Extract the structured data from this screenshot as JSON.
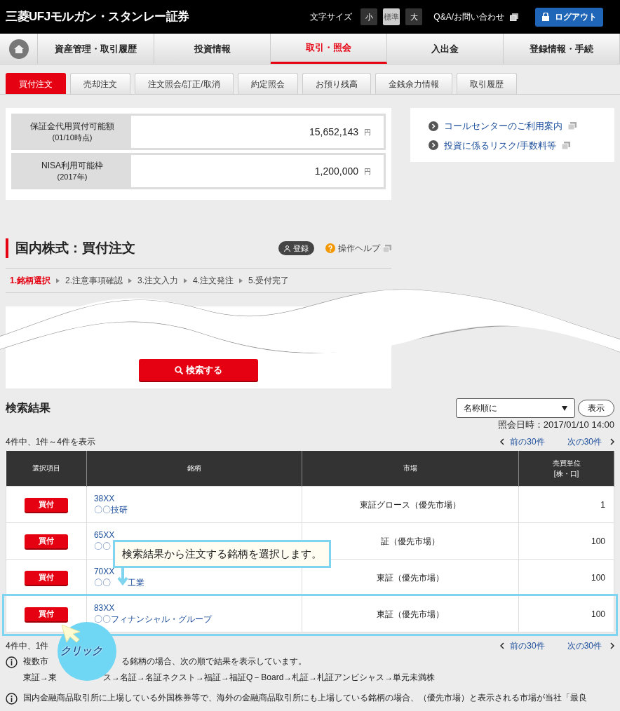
{
  "header": {
    "logo": "三菱UFJモルガン・スタンレー証券",
    "font_size_label": "文字サイズ",
    "font_sizes": [
      {
        "label": "小",
        "selected": false
      },
      {
        "label": "標準",
        "selected": true
      },
      {
        "label": "大",
        "selected": false
      }
    ],
    "help_link": "Q&A/お問い合わせ",
    "logout": "ログアウト"
  },
  "main_nav": [
    {
      "label": "資産管理・取引履歴",
      "selected": false
    },
    {
      "label": "投資情報",
      "selected": false
    },
    {
      "label": "取引・照会",
      "selected": true
    },
    {
      "label": "入出金",
      "selected": false
    },
    {
      "label": "登録情報・手続",
      "selected": false
    }
  ],
  "sub_tabs": [
    {
      "label": "買付注文",
      "selected": true
    },
    {
      "label": "売却注文",
      "selected": false
    },
    {
      "label": "注文照会/訂正/取消",
      "selected": false
    },
    {
      "label": "約定照会",
      "selected": false
    },
    {
      "label": "お預り残高",
      "selected": false
    },
    {
      "label": "金銭余力情報",
      "selected": false
    },
    {
      "label": "取引履歴",
      "selected": false
    }
  ],
  "balances": [
    {
      "label": "保証金代用買付可能額",
      "sub": "(01/10時点)",
      "amount": "15,652,143",
      "unit": "円"
    },
    {
      "label": "NISA利用可能枠",
      "sub": "(2017年)",
      "amount": "1,200,000",
      "unit": "円"
    }
  ],
  "side_links": [
    "コールセンターのご利用案内",
    "投資に係るリスク/手数料等"
  ],
  "page_title": "国内株式：買付注文",
  "register_badge": "登録",
  "help": "操作ヘルプ",
  "steps": [
    {
      "label": "1.銘柄選択",
      "selected": true
    },
    {
      "label": "2.注意事項確認",
      "selected": false
    },
    {
      "label": "3.注文入力",
      "selected": false
    },
    {
      "label": "4.注文発注",
      "selected": false
    },
    {
      "label": "5.受付完了",
      "selected": false
    }
  ],
  "search_button": "検索する",
  "results": {
    "title": "検索結果",
    "sort": {
      "value": "名称順に"
    },
    "show_button": "表示",
    "timestamp": "照会日時：2017/01/10 14:00",
    "count": "4件中、1件～4件を表示",
    "prev": "前の30件",
    "next": "次の30件",
    "columns": [
      {
        "label": "選択項目"
      },
      {
        "label": "銘柄"
      },
      {
        "label": "市場"
      },
      {
        "label": "売買単位",
        "sub": "[株・口]"
      }
    ],
    "rows": [
      {
        "action": "買付",
        "code": "38XX",
        "name_parts": [
          "〇〇技研"
        ],
        "market": "東証グロース（優先市場）",
        "unit": "1",
        "highlighted": false
      },
      {
        "action": "買付",
        "code": "65XX",
        "name_parts": [
          "〇〇"
        ],
        "market": "証（優先市場）",
        "unit": "100",
        "highlighted": false
      },
      {
        "action": "買付",
        "code": "70XX",
        "name_parts": [
          "〇〇",
          "工業"
        ],
        "market": "東証（優先市場）",
        "unit": "100",
        "highlighted": false
      },
      {
        "action": "買付",
        "code": "83XX",
        "name_parts": [
          "〇〇フィナンシャル・グループ"
        ],
        "market": "東証（優先市場）",
        "unit": "100",
        "highlighted": true
      }
    ],
    "count_bottom": "4件中、1件",
    "prev_bottom": "前の30件",
    "next_bottom": "次の30件"
  },
  "notes": [
    {
      "lines": [
        [
          "複数市",
          "る銘柄の場合、次の順で結果を表示しています。"
        ],
        [
          "東証→東",
          "ス→名証→名証ネクスト→福証→福証Q－Board→札証→札証アンビシャス→単元未満株"
        ]
      ]
    },
    {
      "lines": [
        [
          "国内金融商品取引所に上場している外国株券等で、海外の金融商品取引所にも上場している銘柄の場合、（優先市場）と表示される市場が当社「最良"
        ]
      ]
    }
  ],
  "annotations": {
    "callout": "検索結果から注文する銘柄を選択します。",
    "click": "クリック"
  }
}
